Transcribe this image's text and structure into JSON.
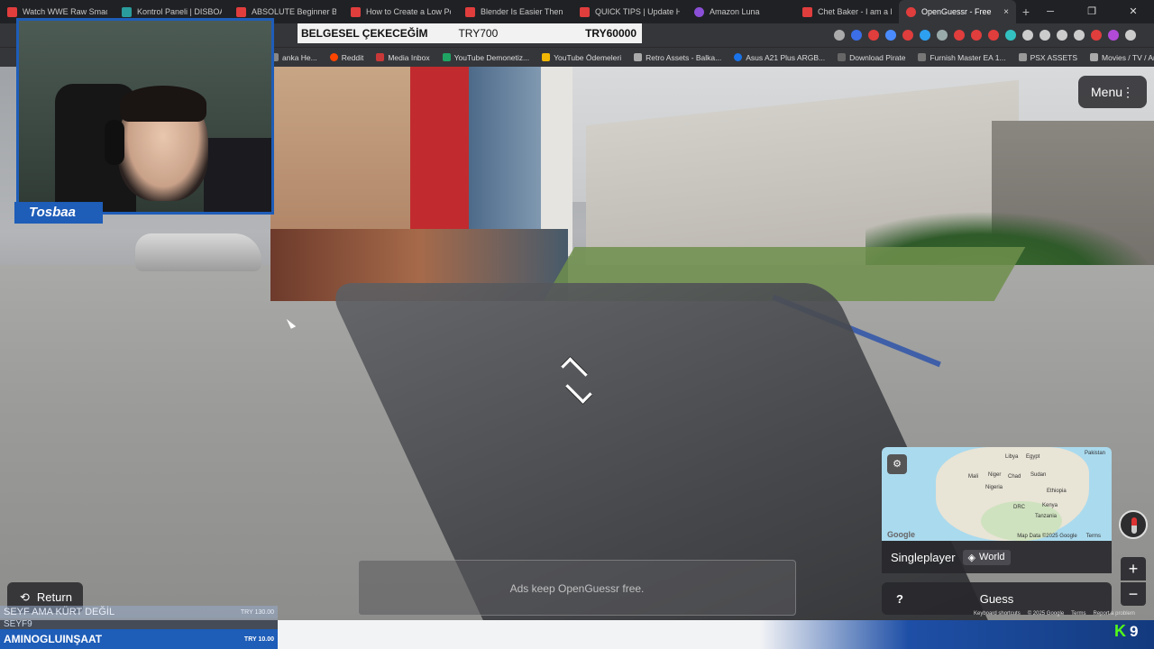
{
  "browser": {
    "tabs": [
      {
        "title": "Watch WWE Raw SmackDo",
        "color": "#e03d3d"
      },
      {
        "title": "Kontrol Paneli | DISBOARD",
        "color": "#2a9c9c"
      },
      {
        "title": "ABSOLUTE Beginner Basic",
        "color": "#e03d3d"
      },
      {
        "title": "How to Create a Low Poly",
        "color": "#e03d3d"
      },
      {
        "title": "Blender Is Easier Then You",
        "color": "#e03d3d"
      },
      {
        "title": "QUICK TIPS | Update Hand",
        "color": "#e03d3d"
      },
      {
        "title": "Amazon Luna",
        "color": "#8a4fd6"
      },
      {
        "title": "Chet Baker - I am a Fo",
        "color": "#e03d3d"
      }
    ],
    "active_tab": {
      "title": "OpenGuessr - Free",
      "color": "#e03d3d",
      "close": "×"
    },
    "new_tab": "+",
    "window_controls": {
      "minimize": "─",
      "maximize": "❐",
      "close": "✕"
    },
    "bookmarks": [
      {
        "label": "anka He...",
        "color": "#888"
      },
      {
        "label": "Reddit",
        "color": "#ff4500"
      },
      {
        "label": "Media Inbox",
        "color": "#c93838"
      },
      {
        "label": "YouTube Demonetiz...",
        "color": "#1fa463"
      },
      {
        "label": "YouTube Ödemeleri",
        "color": "#f2b705"
      },
      {
        "label": "Retro Assets - Balka...",
        "color": "#aaa"
      },
      {
        "label": "Asus A21 Plus ARGB...",
        "color": "#1a73e8"
      },
      {
        "label": "Download Pirate",
        "color": "#666"
      },
      {
        "label": "Furnish Master EA 1...",
        "color": "#777"
      },
      {
        "label": "PSX ASSETS",
        "color": "#999"
      },
      {
        "label": "Movies / TV / Anim...",
        "color": "#aaa"
      }
    ]
  },
  "ticker": {
    "label": "BELGESEL ÇEKECEĞİM",
    "current": "TRY700",
    "goal": "TRY60000"
  },
  "webcam": {
    "name": "Tosbaa"
  },
  "game": {
    "menu_label": "Menu",
    "menu_dots": "⋮",
    "return_label": "Return",
    "return_icon": "⟲",
    "ads_text": "Ads keep OpenGuessr free.",
    "mode": "Singleplayer",
    "region": "World",
    "help_label": "?",
    "guess_label": "Guess",
    "zoom_in": "+",
    "zoom_out": "−",
    "map": {
      "attribution": "Map Data ©2025 Google",
      "terms": "Terms",
      "logo": "Google",
      "settings_icon": "⚙",
      "labels": [
        "Libya",
        "Egypt",
        "Mali",
        "Niger",
        "Chad",
        "Sudan",
        "Nigeria",
        "Ethiopia",
        "Kenya",
        "Tanzania",
        "Pakistan",
        "DRC"
      ]
    },
    "footer_links": [
      "Keyboard shortcuts",
      "© 2025 Google",
      "Terms",
      "Report a problem"
    ]
  },
  "donations": [
    {
      "name": "SEYF AMA KÜRT DEĞİL",
      "amount": "TRY 130.00"
    },
    {
      "name": "SEYF9",
      "amount": ""
    },
    {
      "name": "AMINOGLUINŞAAT",
      "amount": "TRY 10.00"
    }
  ],
  "kick": {
    "logo": "K",
    "count": "9"
  }
}
